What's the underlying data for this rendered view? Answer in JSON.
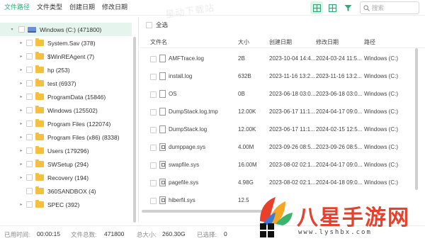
{
  "tabs": [
    "文件路径",
    "文件类型",
    "创建日期",
    "修改日期"
  ],
  "search": {
    "placeholder": "搜索"
  },
  "select_all": "全选",
  "columns": {
    "name": "文件名",
    "size": "大小",
    "created": "创建日期",
    "modified": "修改日期",
    "path": "路径"
  },
  "tree": [
    {
      "label": "Windows (C:) (471800)",
      "type": "drive",
      "selected": true,
      "arrow": "▾"
    },
    {
      "label": "System.Sav (378)",
      "type": "folder",
      "arrow": "▸"
    },
    {
      "label": "$WinREAgent (7)",
      "type": "folder",
      "arrow": "▸"
    },
    {
      "label": "hp (253)",
      "type": "folder",
      "arrow": "▸"
    },
    {
      "label": "test (6937)",
      "type": "folder",
      "arrow": "▸"
    },
    {
      "label": "ProgramData (15846)",
      "type": "folder",
      "arrow": "▸"
    },
    {
      "label": "Windows (125502)",
      "type": "folder",
      "arrow": "▸"
    },
    {
      "label": "Program Files (122074)",
      "type": "folder",
      "arrow": "▸"
    },
    {
      "label": "Program Files (x86) (8338)",
      "type": "folder",
      "arrow": "▸"
    },
    {
      "label": "Users (179296)",
      "type": "folder",
      "arrow": "▸"
    },
    {
      "label": "SWSetup (294)",
      "type": "folder",
      "arrow": "▸"
    },
    {
      "label": "Recovery (194)",
      "type": "folder",
      "arrow": "▸"
    },
    {
      "label": "360SANDBOX (4)",
      "type": "folder",
      "arrow": ""
    },
    {
      "label": "SPEC (392)",
      "type": "folder",
      "arrow": "▸"
    }
  ],
  "files": [
    {
      "name": "AMFTrace.log",
      "size": "2B",
      "created": "2023-10-04 14:4...",
      "modified": "2024-03-24 11:5...",
      "path": "Windows (C:)",
      "icon": "file-icon"
    },
    {
      "name": "install.log",
      "size": "632B",
      "created": "2023-11-16 13:2...",
      "modified": "2023-11-16 13:2...",
      "path": "Windows (C:)",
      "icon": "file-icon"
    },
    {
      "name": "OS",
      "size": "0B",
      "created": "2023-06-18 03:0...",
      "modified": "2023-06-18 03:0...",
      "path": "Windows (C:)",
      "icon": "file-icon"
    },
    {
      "name": "DumpStack.log.tmp",
      "size": "12.00K",
      "created": "2023-06-17 11:1...",
      "modified": "2024-04-17 09:0...",
      "path": "Windows (C:)",
      "icon": "file-icon"
    },
    {
      "name": "DumpStack.log",
      "size": "12.00K",
      "created": "2023-06-17 11:1...",
      "modified": "2024-02-15 12:5...",
      "path": "Windows (C:)",
      "icon": "file-icon"
    },
    {
      "name": "dumppage.sys",
      "size": "4.00M",
      "created": "2023-09-26 08:5...",
      "modified": "2023-09-26 08:5...",
      "path": "Windows (C:)",
      "icon": "system-file-icon"
    },
    {
      "name": "swapfile.sys",
      "size": "16.00M",
      "created": "2023-08-02 02:1...",
      "modified": "2024-04-17 09:0...",
      "path": "Windows (C:)",
      "icon": "system-file-icon"
    },
    {
      "name": "pagefile.sys",
      "size": "4.98G",
      "created": "2023-08-02 02:1...",
      "modified": "2024-04-18 09:0...",
      "path": "Windows (C:)",
      "icon": "system-file-icon"
    },
    {
      "name": "hiberfil.sys",
      "size": "12.5",
      "created": "",
      "modified": "",
      "path": "",
      "icon": "system-file-icon"
    }
  ],
  "status": {
    "time_label": "已用时间:",
    "time_value": "00:00:15",
    "count_label": "文件总数:",
    "count_value": "471800",
    "total_label": "总大小:",
    "total_value": "260.30G",
    "sel_label": "已选择:",
    "sel_value": "0"
  },
  "watermark": {
    "faint": "星动下载站",
    "logo_text": "八星手游网",
    "logo_url": "www.lyshbx.com"
  },
  "colors": {
    "accent": "#2fa877",
    "folder": "#f5c040",
    "logo_red": "#e8402a"
  }
}
